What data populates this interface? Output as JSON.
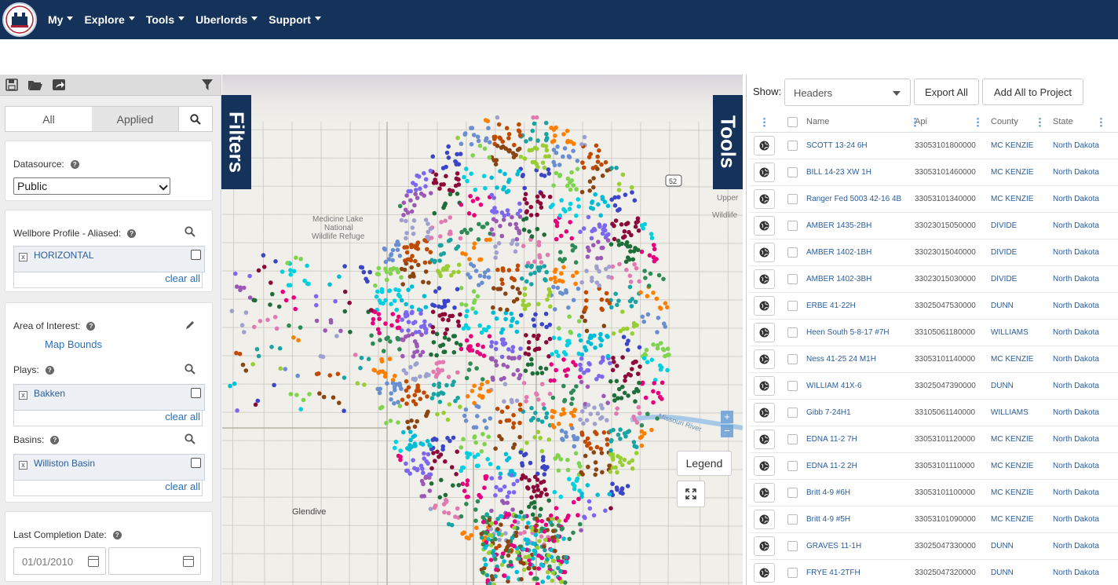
{
  "nav": {
    "menus": [
      {
        "label": "My"
      },
      {
        "label": "Explore"
      },
      {
        "label": "Tools"
      },
      {
        "label": "Uberlords"
      },
      {
        "label": "Support"
      }
    ]
  },
  "filters": {
    "side_label": "Filters",
    "tabs": {
      "all": "All",
      "applied": "Applied"
    },
    "datasource": {
      "label": "Datasource:",
      "value": "Public"
    },
    "wellbore": {
      "label": "Wellbore Profile - Aliased:",
      "chip": "HORIZONTAL",
      "clear": "clear all"
    },
    "aoi": {
      "label": "Area of Interest:",
      "link": "Map Bounds"
    },
    "plays": {
      "label": "Plays:",
      "chip": "Bakken",
      "clear": "clear all"
    },
    "basins": {
      "label": "Basins:",
      "chip": "Williston Basin",
      "clear": "clear all"
    },
    "completion": {
      "label": "Last Completion Date:",
      "start": "01/01/2010",
      "end": ""
    }
  },
  "map": {
    "place_labels": [
      "Medicine Lake",
      "National",
      "Wildlife Refuge",
      "Glendive",
      "Upper",
      "Wildlife",
      "Missouri River",
      "52"
    ],
    "legend_label": "Legend",
    "colors": [
      "#8b4513",
      "#e6007e",
      "#1aa3a3",
      "#00bcd4",
      "#2e8b57",
      "#9acd32",
      "#7b68ee",
      "#ff7f00",
      "#3a45c8",
      "#9b59b6",
      "#6a8fd0",
      "#8b0a3a",
      "#a0a0d0",
      "#7fd34e",
      "#1f6e3a",
      "#c04a00",
      "#00d0e0",
      "#e07ab0"
    ]
  },
  "tools": {
    "side_label": "Tools",
    "show_label": "Show:",
    "show_value": "Headers",
    "export_all": "Export All",
    "add_all": "Add All to Project",
    "columns": {
      "name": "Name",
      "api": "Api",
      "county": "County",
      "state": "State"
    },
    "rows": [
      {
        "name": "SCOTT 13-24 6H",
        "api": "33053101800000",
        "county": "MC KENZIE",
        "state": "North Dakota"
      },
      {
        "name": "BILL 14-23 XW 1H",
        "api": "33053101460000",
        "county": "MC KENZIE",
        "state": "North Dakota"
      },
      {
        "name": "Ranger Fed 5003 42-16 4B",
        "api": "33053101340000",
        "county": "MC KENZIE",
        "state": "North Dakota"
      },
      {
        "name": "AMBER 1435-2BH",
        "api": "33023015050000",
        "county": "DIVIDE",
        "state": "North Dakota"
      },
      {
        "name": "AMBER 1402-1BH",
        "api": "33023015040000",
        "county": "DIVIDE",
        "state": "North Dakota"
      },
      {
        "name": "AMBER 1402-3BH",
        "api": "33023015030000",
        "county": "DIVIDE",
        "state": "North Dakota"
      },
      {
        "name": "ERBE 41-22H",
        "api": "33025047530000",
        "county": "DUNN",
        "state": "North Dakota"
      },
      {
        "name": "Heen South 5-8-17 #7H",
        "api": "33105061180000",
        "county": "WILLIAMS",
        "state": "North Dakota"
      },
      {
        "name": "Ness 41-25 24 M1H",
        "api": "33053101140000",
        "county": "MC KENZIE",
        "state": "North Dakota"
      },
      {
        "name": "WILLIAM 41X-6",
        "api": "33025047390000",
        "county": "DUNN",
        "state": "North Dakota"
      },
      {
        "name": "Gibb 7-24H1",
        "api": "33105061140000",
        "county": "WILLIAMS",
        "state": "North Dakota"
      },
      {
        "name": "EDNA 11-2 7H",
        "api": "33053101120000",
        "county": "MC KENZIE",
        "state": "North Dakota"
      },
      {
        "name": "EDNA 11-2 2H",
        "api": "33053101110000",
        "county": "MC KENZIE",
        "state": "North Dakota"
      },
      {
        "name": "Britt 4-9 #6H",
        "api": "33053101100000",
        "county": "MC KENZIE",
        "state": "North Dakota"
      },
      {
        "name": "Britt 4-9 #5H",
        "api": "33053101090000",
        "county": "MC KENZIE",
        "state": "North Dakota"
      },
      {
        "name": "GRAVES 11-1H",
        "api": "33025047330000",
        "county": "DUNN",
        "state": "North Dakota"
      },
      {
        "name": "FRYE 41-2TFH",
        "api": "33025047320000",
        "county": "DUNN",
        "state": "North Dakota"
      }
    ]
  }
}
